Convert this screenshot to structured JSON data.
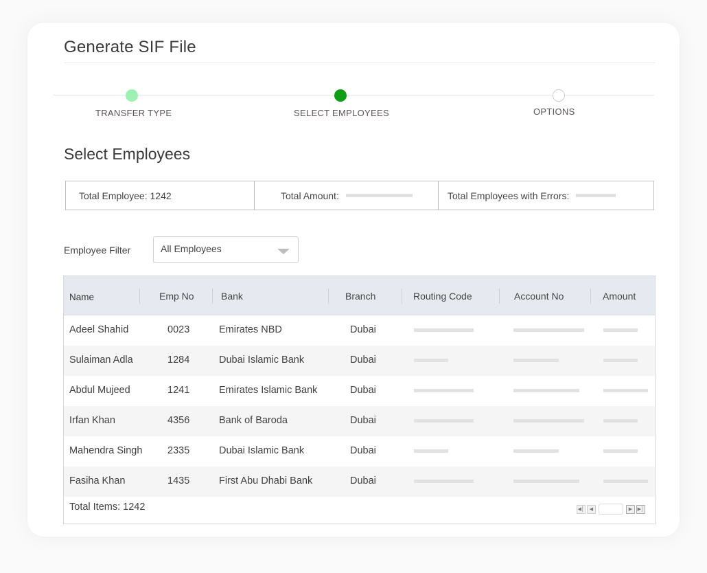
{
  "page": {
    "title": "Generate SIF File",
    "section_title": "Select Employees"
  },
  "stepper": {
    "steps": [
      {
        "label": "TRANSFER TYPE",
        "state": "completed",
        "color": "#9ff0b3"
      },
      {
        "label": "SELECT EMPLOYEES",
        "state": "active",
        "color": "#0f9d15"
      },
      {
        "label": "OPTIONS",
        "state": "pending",
        "color": "#ffffff"
      }
    ]
  },
  "summary": {
    "total_employee": "Total Employee: 1242",
    "total_amount_label": "Total Amount:",
    "total_errors_label": "Total Employees with Errors:"
  },
  "filter": {
    "label": "Employee Filter",
    "selected": "All Employees"
  },
  "table": {
    "columns": [
      "Name",
      "Emp No",
      "Bank",
      "Branch",
      "Routing Code",
      "Account No",
      "Amount"
    ],
    "rows": [
      {
        "name": "Adeel Shahid",
        "emp_no": "0023",
        "bank": "Emirates NBD",
        "branch": "Dubai"
      },
      {
        "name": "Sulaiman Adla",
        "emp_no": "1284",
        "bank": "Dubai Islamic Bank",
        "branch": "Dubai"
      },
      {
        "name": "Abdul Mujeed",
        "emp_no": "1241",
        "bank": "Emirates Islamic Bank",
        "branch": "Dubai"
      },
      {
        "name": "Irfan Khan",
        "emp_no": "4356",
        "bank": "Bank of Baroda",
        "branch": "Dubai"
      },
      {
        "name": "Mahendra Singh",
        "emp_no": "2335",
        "bank": "Dubai Islamic Bank",
        "branch": "Dubai"
      },
      {
        "name": "Fasiha Khan",
        "emp_no": "1435",
        "bank": "First Abu Dhabi Bank",
        "branch": "Dubai"
      }
    ],
    "footer": {
      "total_items": "Total Items: 1242",
      "pager_icons": [
        "first-page-icon",
        "prev-page-icon",
        "next-page-icon",
        "last-page-icon"
      ]
    }
  }
}
